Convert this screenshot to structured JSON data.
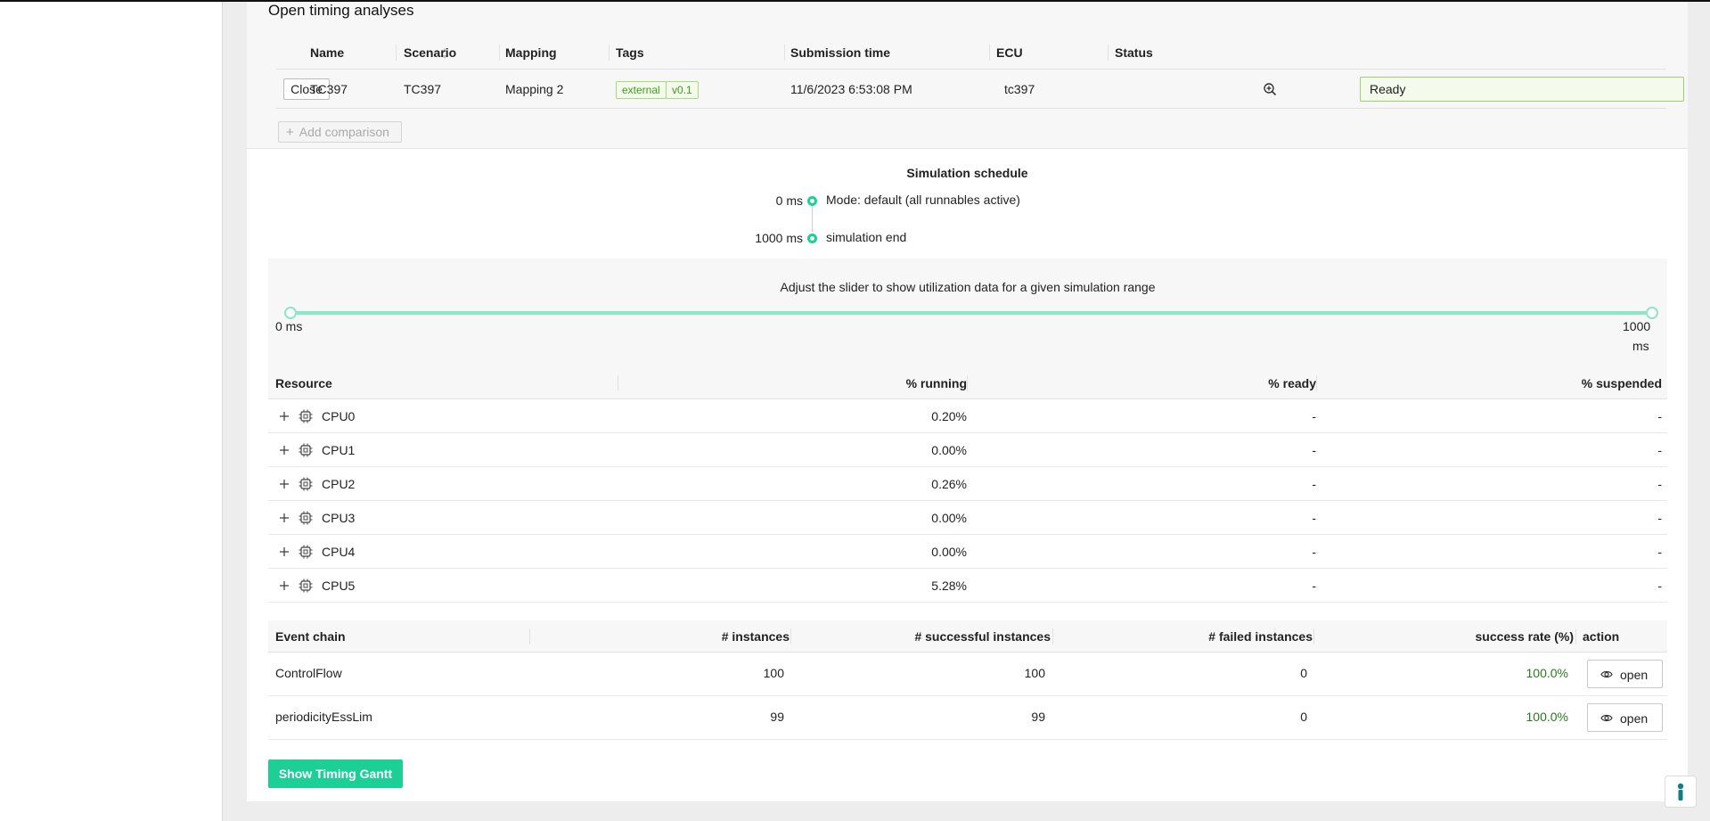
{
  "section_title": "Open timing analyses",
  "analyses_table": {
    "columns": {
      "name": "Name",
      "scenario": "Scenario",
      "mapping": "Mapping",
      "tags": "Tags",
      "submission_time": "Submission time",
      "ecu": "ECU",
      "status": "Status"
    },
    "row": {
      "close_label": "Close",
      "name": "TC397",
      "scenario": "TC397",
      "mapping": "Mapping 2",
      "tags": [
        "external",
        "v0.1"
      ],
      "submission_time": "11/6/2023 6:53:08 PM",
      "ecu": "tc397",
      "status": "Ready"
    },
    "add_comparison_label": "Add comparison"
  },
  "simulation_schedule": {
    "title": "Simulation schedule",
    "entries": [
      {
        "time": "0 ms",
        "label": "Mode: default (all runnables active)"
      },
      {
        "time": "1000 ms",
        "label": "simulation end"
      }
    ]
  },
  "range_slider": {
    "caption": "Adjust the slider to show utilization data for a given simulation range",
    "min_label": "0 ms",
    "max_label_value": "1000",
    "max_label_unit": "ms",
    "range_start_fraction": 0,
    "range_end_fraction": 1
  },
  "resource_table": {
    "columns": {
      "resource": "Resource",
      "running": "% running",
      "ready": "% ready",
      "suspended": "% suspended"
    },
    "rows": [
      {
        "name": "CPU0",
        "running": "0.20%",
        "ready": "-",
        "suspended": "-"
      },
      {
        "name": "CPU1",
        "running": "0.00%",
        "ready": "-",
        "suspended": "-"
      },
      {
        "name": "CPU2",
        "running": "0.26%",
        "ready": "-",
        "suspended": "-"
      },
      {
        "name": "CPU3",
        "running": "0.00%",
        "ready": "-",
        "suspended": "-"
      },
      {
        "name": "CPU4",
        "running": "0.00%",
        "ready": "-",
        "suspended": "-"
      },
      {
        "name": "CPU5",
        "running": "5.28%",
        "ready": "-",
        "suspended": "-"
      }
    ]
  },
  "event_chain_table": {
    "columns": {
      "event_chain": "Event chain",
      "instances": "# instances",
      "successful": "# successful instances",
      "failed": "# failed instances",
      "success_rate": "success rate (%)",
      "action": "action"
    },
    "rows": [
      {
        "name": "ControlFlow",
        "instances": "100",
        "successful": "100",
        "failed": "0",
        "success_rate": "100.0%",
        "action_label": "open"
      },
      {
        "name": "periodicityEssLim",
        "instances": "99",
        "successful": "99",
        "failed": "0",
        "success_rate": "100.0%",
        "action_label": "open"
      }
    ]
  },
  "show_gantt_label": "Show Timing Gantt",
  "icons": {
    "sort": "sort-icon",
    "zoom": "zoom-in-icon",
    "expand": "plus-icon",
    "resource": "chip-icon",
    "view": "eye-icon",
    "help": "help-icon"
  },
  "colors": {
    "accent": "#1ccf95",
    "status_ready_bg": "#f4fbec",
    "status_ready_border": "#9ad16f",
    "tag_text": "#3f9a22",
    "success_rate_text": "#2b7a1f"
  }
}
